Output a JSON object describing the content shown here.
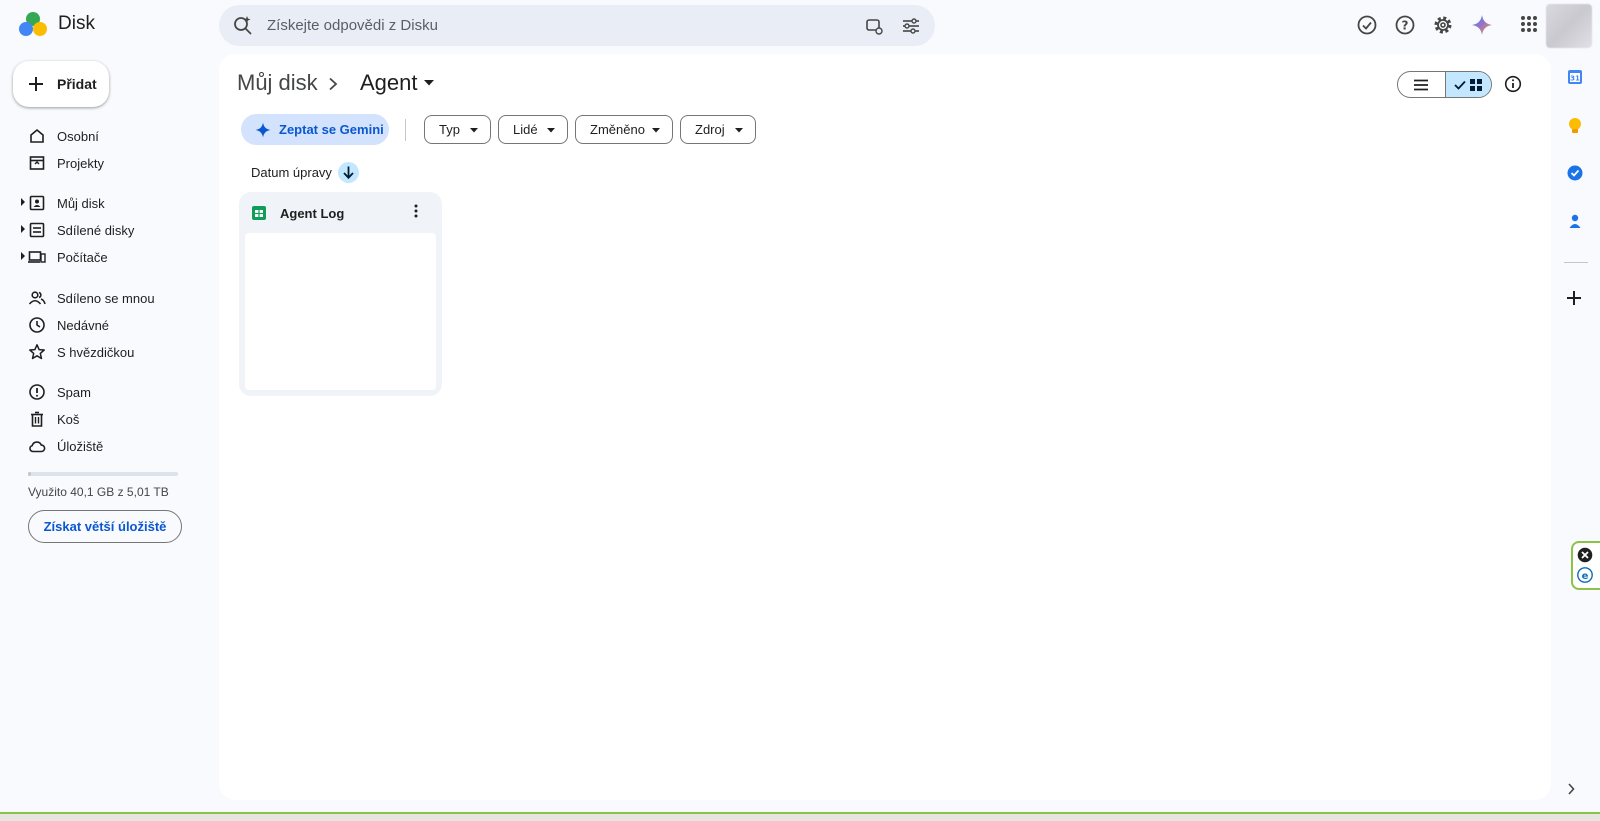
{
  "app": {
    "title": "Disk"
  },
  "search": {
    "placeholder": "Získejte odpovědi z Disku"
  },
  "sidebar": {
    "new_label": "Přidat",
    "items": [
      {
        "label": "Osobní",
        "icon": "home-icon"
      },
      {
        "label": "Projekty",
        "icon": "projects-icon"
      },
      {
        "label": "Můj disk",
        "icon": "my-drive-icon"
      },
      {
        "label": "Sdílené disky",
        "icon": "shared-drives-icon"
      },
      {
        "label": "Počítače",
        "icon": "computers-icon"
      },
      {
        "label": "Sdíleno se mnou",
        "icon": "shared-with-me-icon"
      },
      {
        "label": "Nedávné",
        "icon": "recent-icon"
      },
      {
        "label": "S hvězdičkou",
        "icon": "star-icon"
      },
      {
        "label": "Spam",
        "icon": "spam-icon"
      },
      {
        "label": "Koš",
        "icon": "trash-icon"
      },
      {
        "label": "Úložiště",
        "icon": "cloud-icon"
      }
    ],
    "storage_text": "Využito 40,1 GB z 5,01 TB",
    "storage_used_fraction": 0.008,
    "storage_button": "Získat větší úložiště"
  },
  "breadcrumb": {
    "root": "Můj disk",
    "current": "Agent"
  },
  "filters": {
    "gemini": "Zeptat se Gemini",
    "chips": [
      "Typ",
      "Lidé",
      "Změněno",
      "Zdroj"
    ]
  },
  "sort": {
    "label": "Datum úpravy",
    "direction": "descending"
  },
  "files": [
    {
      "name": "Agent Log",
      "type": "spreadsheet"
    }
  ],
  "view": {
    "mode": "grid"
  },
  "colors": {
    "accent": "#0b57d0",
    "sheets_green": "#0f9d58",
    "background": "#f8fafd"
  }
}
